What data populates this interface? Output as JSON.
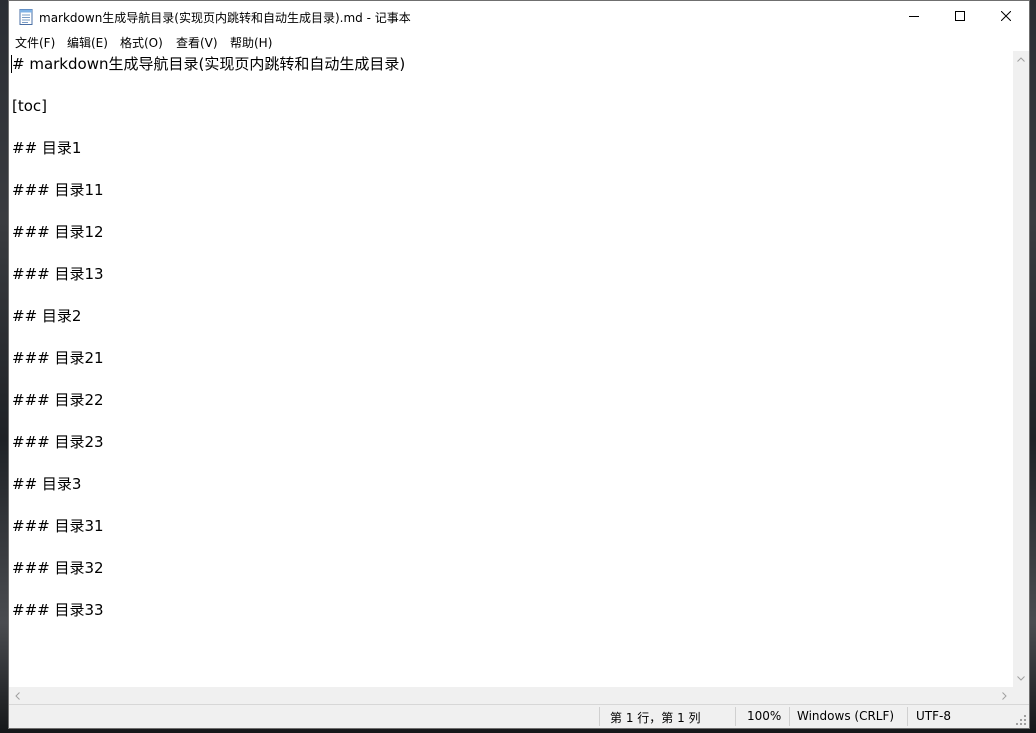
{
  "window": {
    "title": "markdown生成导航目录(实现页内跳转和自动生成目录).md - 记事本",
    "icon": "notepad-icon"
  },
  "menu": [
    "文件(F)",
    "编辑(E)",
    "格式(O)",
    "查看(V)",
    "帮助(H)"
  ],
  "editor": {
    "lines": [
      "# markdown生成导航目录(实现页内跳转和自动生成目录)",
      "",
      "[toc]",
      "",
      "## 目录1",
      "",
      "### 目录11",
      "",
      "### 目录12",
      "",
      "### 目录13",
      "",
      "## 目录2",
      "",
      "### 目录21",
      "",
      "### 目录22",
      "",
      "### 目录23",
      "",
      "## 目录3",
      "",
      "### 目录31",
      "",
      "### 目录32",
      "",
      "### 目录33"
    ]
  },
  "status": {
    "position": "第 1 行，第 1 列",
    "zoom": "100%",
    "line_ending": "Windows (CRLF)",
    "encoding": "UTF-8"
  }
}
